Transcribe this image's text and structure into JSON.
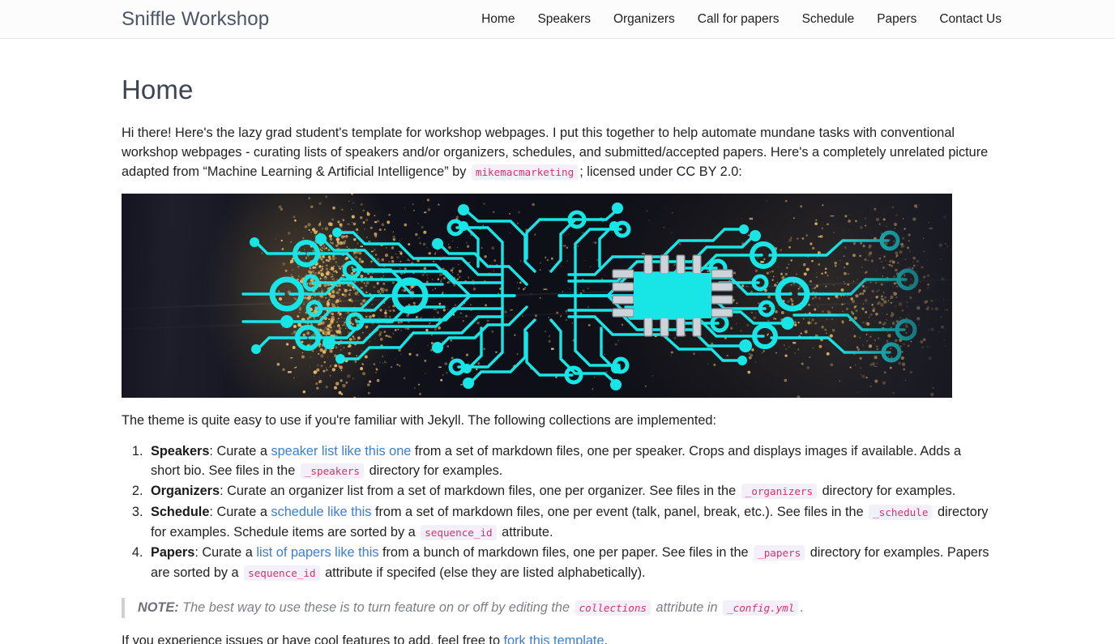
{
  "site": {
    "brand": "Sniffle Workshop"
  },
  "nav": {
    "items": [
      {
        "label": "Home"
      },
      {
        "label": "Speakers"
      },
      {
        "label": "Organizers"
      },
      {
        "label": "Call for papers"
      },
      {
        "label": "Schedule"
      },
      {
        "label": "Papers"
      },
      {
        "label": "Contact Us"
      }
    ]
  },
  "page": {
    "title": "Home",
    "intro": {
      "part1": "Hi there! Here's the lazy grad student's template for workshop webpages. I put this together to help automate mundane tasks with conventional workshop webpages - curating lists of speakers and/or organizers, schedules, and submitted/accepted papers. Here's a completely unrelated picture adapted from “Machine Learning & Artificial Intelligence” by ",
      "code_author": "mikemacmarketing",
      "part2": "; licensed under CC BY 2.0:"
    },
    "hero_image": {
      "alt": "Machine Learning & Artificial Intelligence — cyan circuit board with central processor on a dark background",
      "circuit_color": "#18E6E6",
      "background_color": "#121320",
      "particle_color": "#E2B567"
    },
    "lead_in": "The theme is quite easy to use if you're familiar with Jekyll. The following collections are implemented:",
    "features": [
      {
        "term": "Speakers",
        "t1": ": Curate a ",
        "link": "speaker list like this one",
        "t2": " from a set of markdown files, one per speaker. Crops and displays images if available. Adds a short bio. See files in the ",
        "code": "_speakers",
        "t3": " directory for examples."
      },
      {
        "term": "Organizers",
        "t1": ": Curate an organizer list from a set of markdown files, one per organizer. See files in the ",
        "link": "",
        "t2": "",
        "code": "_organizers",
        "t3": " directory for examples."
      },
      {
        "term": "Schedule",
        "t1": ": Curate a ",
        "link": "schedule like this",
        "t2": " from a set of markdown files, one per event (talk, panel, break, etc.). See files in the ",
        "code": "_schedule",
        "t3": " directory for examples. Schedule items are sorted by a ",
        "code2": "sequence_id",
        "t4": " attribute."
      },
      {
        "term": "Papers",
        "t1": ": Curate a ",
        "link": "list of papers like this",
        "t2": " from a bunch of markdown files, one per paper. See files in the ",
        "code": "_papers",
        "t3": " directory for examples. Papers are sorted by a ",
        "code2": "sequence_id",
        "t4": " attribute if specifed (else they are listed alphabetically)."
      }
    ],
    "note": {
      "label": "NOTE:",
      "t1": " The best way to use these is to turn feature on or off by editing the ",
      "code1": "collections",
      "t2": " attribute in ",
      "code2": "_config.yml",
      "t3": "."
    },
    "outro": {
      "t1": "If you experience issues or have cool features to add, feel free to ",
      "link": "fork this template",
      "t2": "."
    }
  },
  "colors": {
    "link": "#3b7dd8",
    "code_text": "#d6336c",
    "code_bg": "#f3f0f9",
    "brand_text": "#4a5568",
    "nav_bg": "#fcfcfc"
  }
}
